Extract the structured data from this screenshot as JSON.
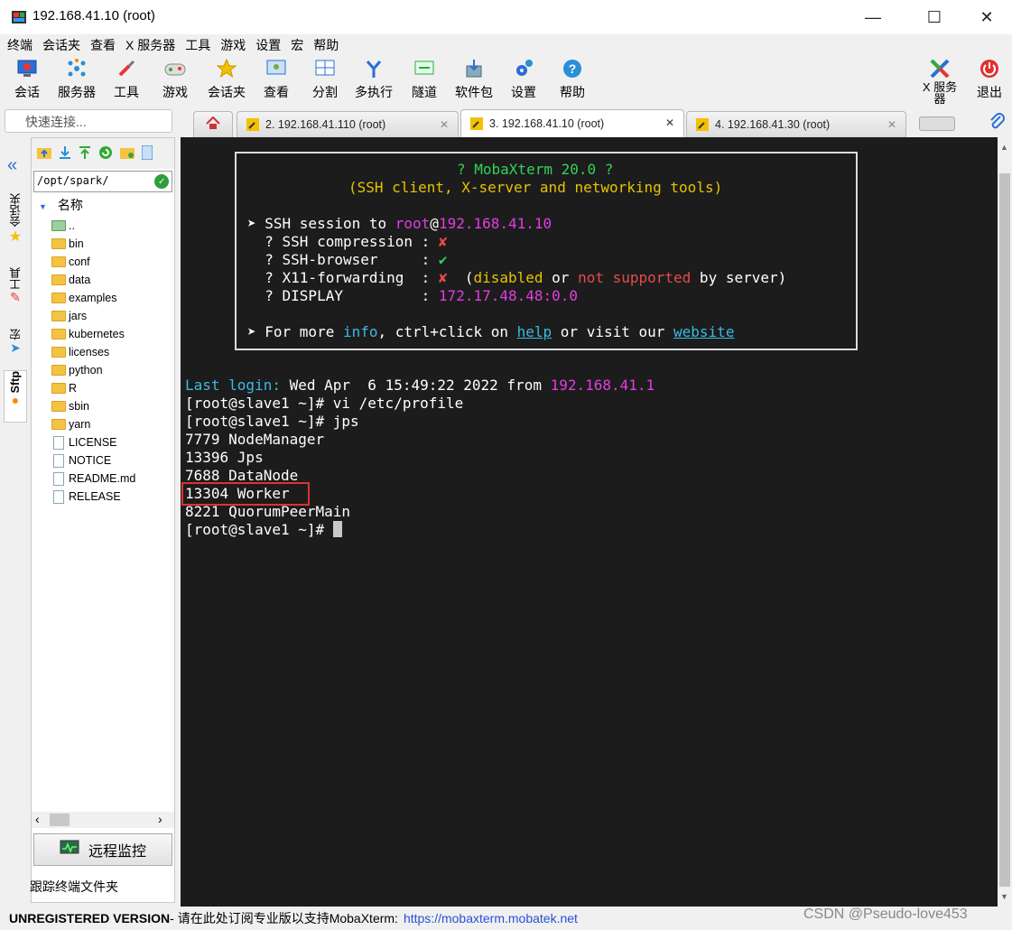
{
  "window": {
    "title": "192.168.41.10 (root)",
    "minimize": "—",
    "maximize": "☐",
    "close": "✕"
  },
  "menu": [
    "终端",
    "会话夹",
    "查看",
    "X 服务器",
    "工具",
    "游戏",
    "设置",
    "宏",
    "帮助"
  ],
  "toolbar": {
    "left": [
      "会话",
      "服务器",
      "工具",
      "游戏",
      "会话夹",
      "查看",
      "分割",
      "多执行",
      "隧道",
      "软件包",
      "设置",
      "帮助"
    ],
    "xserver": "X 服务器",
    "exit": "退出"
  },
  "quick_connect": {
    "placeholder": "快速连接..."
  },
  "tabs": [
    {
      "label": "2. 192.168.41.110 (root)",
      "close": "✕"
    },
    {
      "label": "3. 192.168.41.10 (root)",
      "close": "✕"
    },
    {
      "label": "4. 192.168.41.30 (root)",
      "close": "✕"
    }
  ],
  "side_tabs": [
    "会话夹",
    "工具",
    "宏",
    "Sftp"
  ],
  "sftp": {
    "path": "/opt/spark/",
    "ok": "✓",
    "column": "名称",
    "entries": [
      {
        "name": "..",
        "type": "up"
      },
      {
        "name": "bin",
        "type": "folder"
      },
      {
        "name": "conf",
        "type": "folder"
      },
      {
        "name": "data",
        "type": "folder"
      },
      {
        "name": "examples",
        "type": "folder"
      },
      {
        "name": "jars",
        "type": "folder"
      },
      {
        "name": "kubernetes",
        "type": "folder"
      },
      {
        "name": "licenses",
        "type": "folder"
      },
      {
        "name": "python",
        "type": "folder"
      },
      {
        "name": "R",
        "type": "folder"
      },
      {
        "name": "sbin",
        "type": "folder"
      },
      {
        "name": "yarn",
        "type": "folder"
      },
      {
        "name": "LICENSE",
        "type": "file"
      },
      {
        "name": "NOTICE",
        "type": "file"
      },
      {
        "name": "README.md",
        "type": "file"
      },
      {
        "name": "RELEASE",
        "type": "file"
      }
    ],
    "remote_monitor": "远程监控",
    "follow_folder": "跟踪终端文件夹"
  },
  "terminal": {
    "banner_title": "? MobaXterm 20.0 ?",
    "banner_sub": "(SSH client, X-server and networking tools)",
    "ssh_prefix": "➤ SSH session to ",
    "ssh_user": "root",
    "ssh_at": "@",
    "ssh_host": "192.168.41.10",
    "compression_label": "  ? SSH compression : ",
    "compression_val": "✘",
    "browser_label": "  ? SSH-browser     : ",
    "browser_val": "✔",
    "x11_label": "  ? X11-forwarding  : ",
    "x11_val": "✘",
    "x11_note_open": "  (",
    "x11_disabled": "disabled",
    "x11_or": " or ",
    "x11_not": "not supported",
    "x11_by": " by server)",
    "display_label": "  ? DISPLAY         : ",
    "display_val": "172.17.48.48:0.0",
    "more_prefix": "➤ For more ",
    "more_info": "info",
    "more_mid": ", ctrl+click on ",
    "more_help": "help",
    "more_or": " or visit our ",
    "more_site": "website",
    "last_login_label": "Last login:",
    "last_login_text": " Wed Apr  6 15:49:22 2022 from ",
    "last_login_ip": "192.168.41.1",
    "lines": [
      "[root@slave1 ~]# vi /etc/profile",
      "[root@slave1 ~]# jps",
      "7779 NodeManager",
      "13396 Jps",
      "7688 DataNode",
      "13304 Worker",
      "8221 QuorumPeerMain"
    ],
    "prompt": "[root@slave1 ~]# "
  },
  "status": {
    "unregistered": "UNREGISTERED VERSION",
    "message": " - 请在此处订阅专业版以支持MobaXterm: ",
    "link": "https://mobaxterm.mobatek.net"
  },
  "watermark": "CSDN @Pseudo-love453",
  "colors": {
    "terminal_bg": "#1c1c1c",
    "green": "#30d45a",
    "yellow": "#e6c300",
    "magenta": "#e23de2",
    "cyan": "#3cb8e6",
    "highlight": "#e23030"
  }
}
